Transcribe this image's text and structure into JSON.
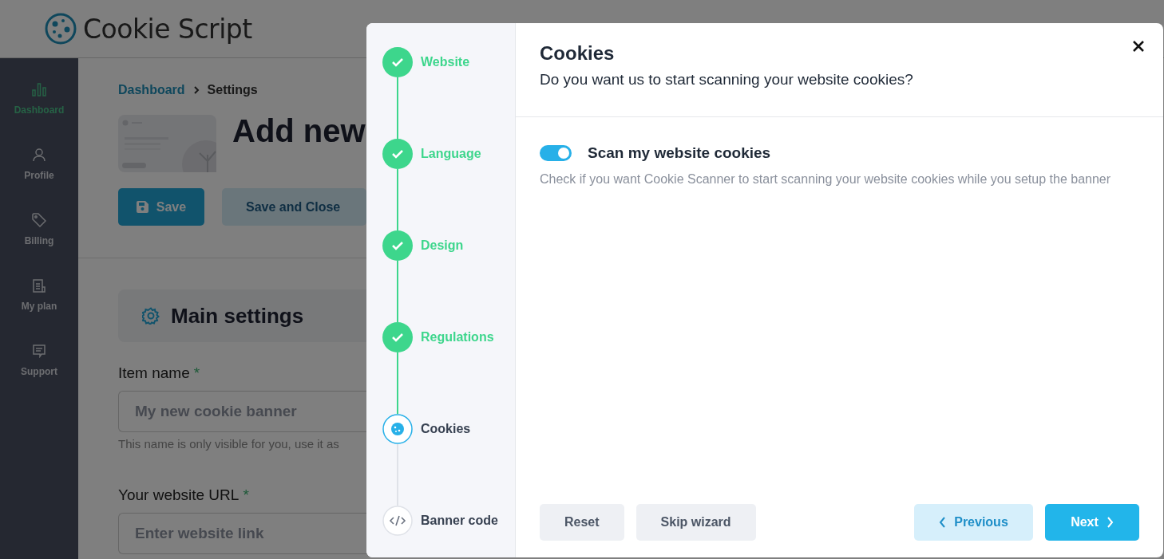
{
  "header": {
    "logo_text": "Cookie Script"
  },
  "sidebar": {
    "items": [
      {
        "label": "Dashboard",
        "selected": true
      },
      {
        "label": "Profile",
        "selected": false
      },
      {
        "label": "Billing",
        "selected": false
      },
      {
        "label": "My plan",
        "selected": false
      },
      {
        "label": "Support",
        "selected": false
      }
    ]
  },
  "breadcrumb": [
    {
      "label": "Dashboard",
      "kind": "link"
    },
    {
      "label": "Settings",
      "kind": "current"
    }
  ],
  "page_title": "Add new",
  "actions": [
    {
      "label": "Save",
      "kind": "primary"
    },
    {
      "label": "Save and Close",
      "kind": "secondary"
    }
  ],
  "section": {
    "title": "Main settings"
  },
  "fields": [
    {
      "label": "Item name",
      "required_mark": "*",
      "placeholder": "My new cookie banner",
      "hint": "This name is only visible for you, use it as"
    },
    {
      "label": "Your website URL",
      "required_mark": "*",
      "placeholder": "Enter website link"
    }
  ],
  "wizard": {
    "steps": [
      {
        "label": "Website",
        "kind": "done"
      },
      {
        "label": "Language",
        "kind": "done"
      },
      {
        "label": "Design",
        "kind": "done"
      },
      {
        "label": "Regulations",
        "kind": "done"
      },
      {
        "label": "Cookies",
        "kind": "current"
      },
      {
        "label": "Banner code",
        "kind": "upcoming"
      }
    ],
    "title": "Cookies",
    "subtitle": "Do you want us to start scanning your website cookies?",
    "option": {
      "label": "Scan my website cookies",
      "on": true,
      "description": "Check if you want Cookie Scanner to start scanning your website cookies while you setup the banner"
    },
    "left_buttons": [
      "Reset",
      "Skip wizard"
    ],
    "previous": "Previous",
    "next": "Next"
  }
}
